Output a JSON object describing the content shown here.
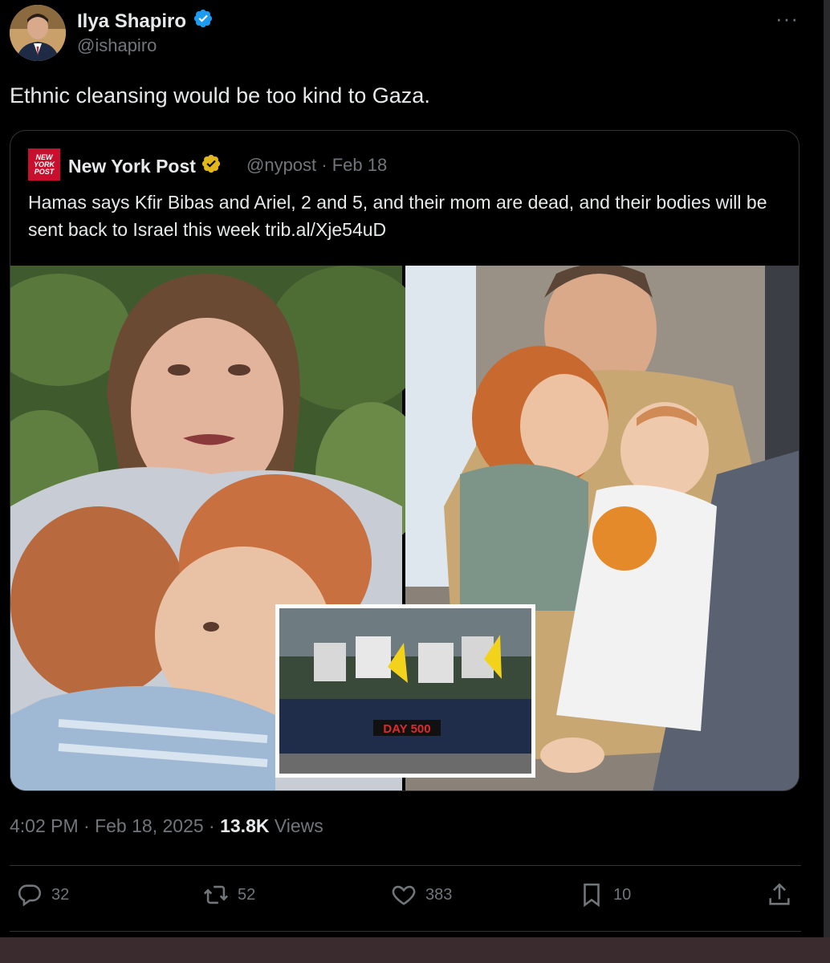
{
  "author": {
    "name": "Ilya Shapiro",
    "handle": "@ishapiro",
    "verified_color": "#1d9bf0",
    "avatar_icon": "profile-photo"
  },
  "tweet": {
    "text": "Ethnic cleansing would be too kind to Gaza."
  },
  "quoted": {
    "logo_text": "NEW YORK POST",
    "name": "New York Post",
    "verified_color": "#e2b719",
    "handle_date": "@nypost · Feb 18",
    "text": "Hamas says Kfir Bibas and Ariel, 2 and 5, and their mom are dead, and their bodies will be sent back to Israel this week trib.al/Xje54uD",
    "banner_text": "DAY 500"
  },
  "meta": {
    "time_date": "4:02 PM · Feb 18, 2025 · ",
    "views_count": "13.8K",
    "views_label": " Views"
  },
  "actions": {
    "replies": "32",
    "reposts": "52",
    "likes": "383",
    "bookmarks": "10"
  },
  "colors": {
    "background": "#000000",
    "text": "#e7e9ea",
    "muted": "#71767b",
    "border": "#2f3336",
    "accent": "#1d9bf0"
  }
}
